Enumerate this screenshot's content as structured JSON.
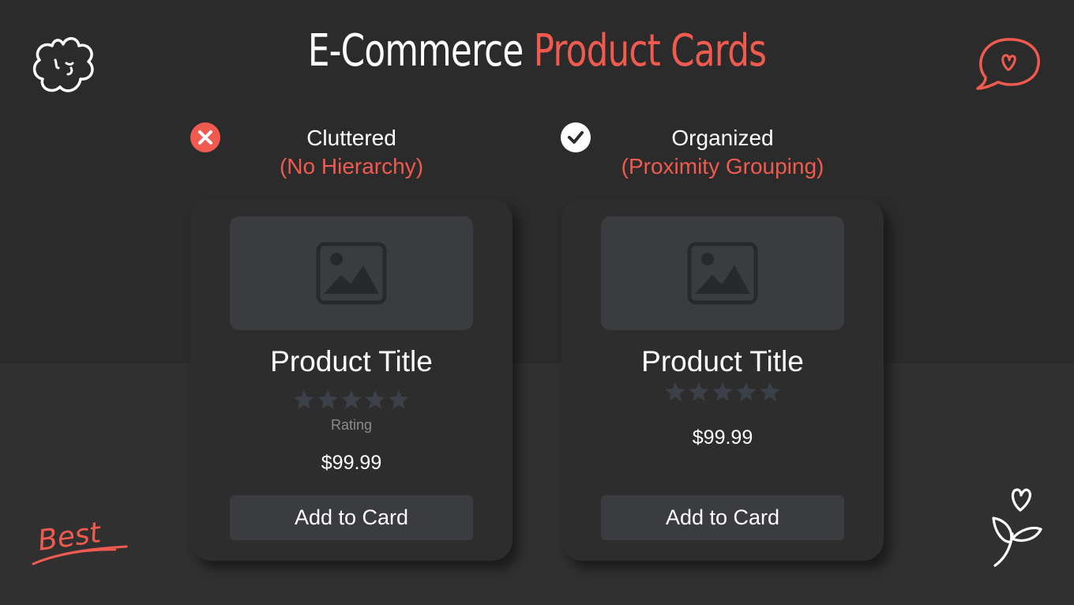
{
  "title": {
    "part1": "E-Commerce",
    "part2": "Product Cards"
  },
  "colors": {
    "accent": "#f05a4f",
    "background": "#2b2b2b",
    "card": "#2d2d2d",
    "placeholder": "#3a3c40",
    "star": "#3c4048"
  },
  "decorations": {
    "best_text": "Best"
  },
  "comparison": [
    {
      "status": "bad",
      "icon": "close-icon",
      "label": "Cluttered",
      "sublabel": "(No Hierarchy)",
      "card": {
        "image_icon": "image-placeholder-icon",
        "product_title": "Product Title",
        "stars": 5,
        "rating_label": "Rating",
        "price": "$99.99",
        "button_label": "Add to Card"
      }
    },
    {
      "status": "good",
      "icon": "check-icon",
      "label": "Organized",
      "sublabel": "(Proximity Grouping)",
      "card": {
        "image_icon": "image-placeholder-icon",
        "product_title": "Product Title",
        "stars": 5,
        "price": "$99.99",
        "button_label": "Add to Card"
      }
    }
  ]
}
